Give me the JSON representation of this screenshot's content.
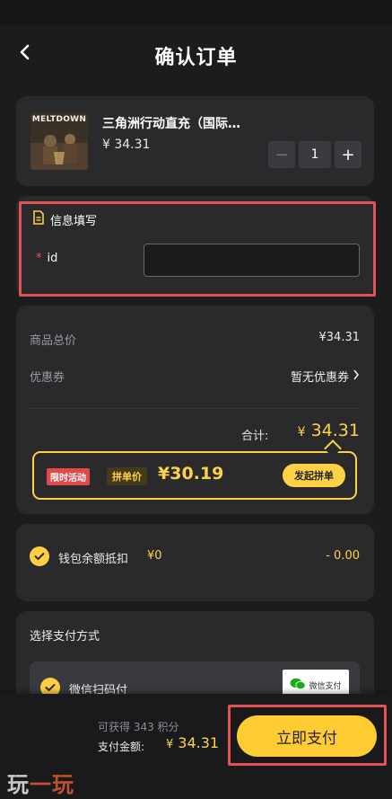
{
  "header": {
    "title": "确认订单"
  },
  "product": {
    "thumb_text": "MELTDOWN",
    "name": "三角洲行动直充（国际…",
    "price": "¥ 34.31",
    "quantity": "1",
    "minus": "−",
    "plus": "+"
  },
  "info": {
    "title": "信息填写",
    "required_mark": "*",
    "field_label": "id",
    "field_value": "",
    "field_placeholder": ""
  },
  "summary": {
    "goods_total_label": "商品总价",
    "goods_total_value": "¥34.31",
    "coupon_label": "优惠券",
    "coupon_value": "暂无优惠券",
    "total_label": "合计:",
    "total_currency": "¥",
    "total_value": "34.31"
  },
  "group_buy": {
    "tag_limited": "限时活动",
    "tag_group_price": "拼单价",
    "price": "¥30.19",
    "button": "发起拼单"
  },
  "wallet": {
    "label": "钱包余额抵扣",
    "balance": "¥0",
    "deduction": "- 0.00"
  },
  "payment_method": {
    "title": "选择支付方式",
    "option_label": "微信扫码付",
    "logo_text": "微信支付"
  },
  "bottom": {
    "points": "可获得 343 积分",
    "pay_label": "支付金额:",
    "pay_currency": "¥",
    "pay_amount": "34.31",
    "pay_button": "立即支付"
  },
  "watermark": {
    "part1": "玩",
    "part2": "一玩"
  },
  "colors": {
    "accent": "#ffd246",
    "button": "#ffcc33",
    "highlight": "#e05455",
    "background": "#1c1c1e",
    "card": "#2a2a2d"
  },
  "icons": [
    "back-arrow-icon",
    "document-icon",
    "chevron-right-icon",
    "check-circle-icon",
    "wechat-pay-logo-icon"
  ]
}
